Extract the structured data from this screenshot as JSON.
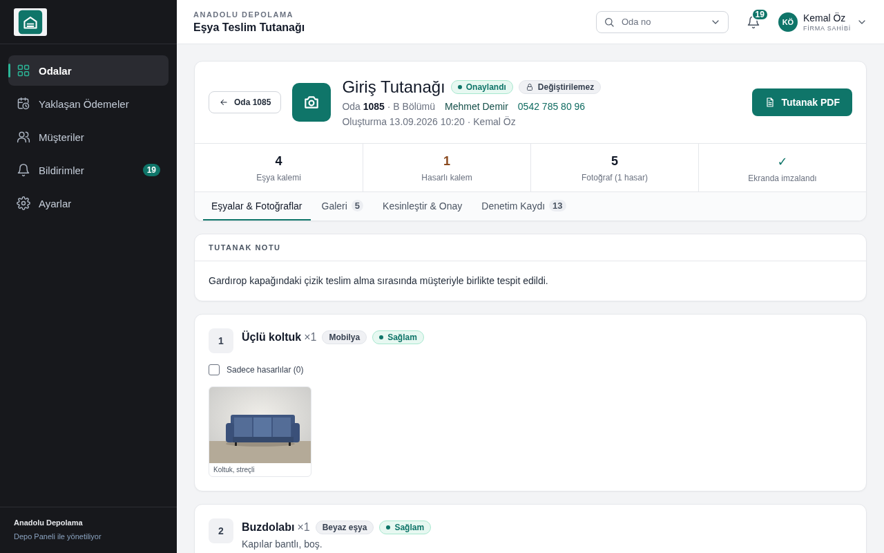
{
  "sidebar": {
    "items": [
      {
        "label": "Odalar",
        "selected": true
      },
      {
        "label": "Yaklaşan Ödemeler",
        "selected": false
      },
      {
        "label": "Müşteriler",
        "selected": false
      },
      {
        "label": "Bildirimler",
        "selected": false,
        "count": "19"
      },
      {
        "label": "Ayarlar",
        "selected": false
      }
    ],
    "footer": {
      "company": "Anadolu Depolama",
      "note": "Depo Paneli ile yönetiliyor"
    }
  },
  "header": {
    "eyebrow": "ANADOLU DEPOLAMA",
    "title": "Eşya Teslim Tutanağı",
    "search": {
      "placeholder": "Oda no"
    },
    "notifications": "19",
    "user": {
      "initials": "KÖ",
      "name": "Kemal Öz",
      "role": "FİRMA SAHİBİ"
    }
  },
  "record": {
    "back": "Oda 1085",
    "title": "Giriş Tutanağı",
    "badges": [
      {
        "kind": "status",
        "label": "Onaylandı"
      },
      {
        "kind": "lock",
        "label": "Değiştirilemez"
      }
    ],
    "room": "Oda **1085** · B Bölümü",
    "customer": "Mehmet Demir",
    "phone": "0542 785 80 96",
    "created": "Oluşturma 13.09.2026 10:20 · Kemal Öz",
    "pdf_button": "Tutanak PDF",
    "stats": [
      {
        "value": "4",
        "label": "Eşya kalemi",
        "color": "#111827"
      },
      {
        "value": "1",
        "label": "Hasarlı kalem",
        "color": "#8a4a1f"
      },
      {
        "value": "5",
        "label": "Fotoğraf (1 hasar)",
        "color": "#111827"
      },
      {
        "value": "✓",
        "label": "Ekranda imzalandı",
        "color": "#0f7569"
      }
    ],
    "tabs": [
      {
        "label": "Eşyalar & Fotoğraflar",
        "selected": true
      },
      {
        "label": "Galeri",
        "count": "5",
        "selected": false
      },
      {
        "label": "Kesinleştir & Onay",
        "selected": false
      },
      {
        "label": "Denetim Kaydı",
        "count": "13",
        "selected": false
      }
    ]
  },
  "note": {
    "heading": "TUTANAK NOTU",
    "text": "Gardırop kapağındaki çizik teslim alma sırasında müşteriyle birlikte tespit edildi."
  },
  "items": [
    {
      "number": "1",
      "name": "Üçlü koltuk",
      "quantity": "×1",
      "category": "Mobilya",
      "condition_label": "Sağlam",
      "filter": {
        "label": "Sadece hasarlılar (0)",
        "checked": false
      },
      "photos": [
        {
          "kind": "picture",
          "caption": "Koltuk, streçli"
        }
      ]
    },
    {
      "number": "2",
      "name": "Buzdolabı",
      "quantity": "×1",
      "category": "Beyaz eşya",
      "condition_label": "Sağlam",
      "description": "Kapılar bantlı, boş."
    }
  ]
}
